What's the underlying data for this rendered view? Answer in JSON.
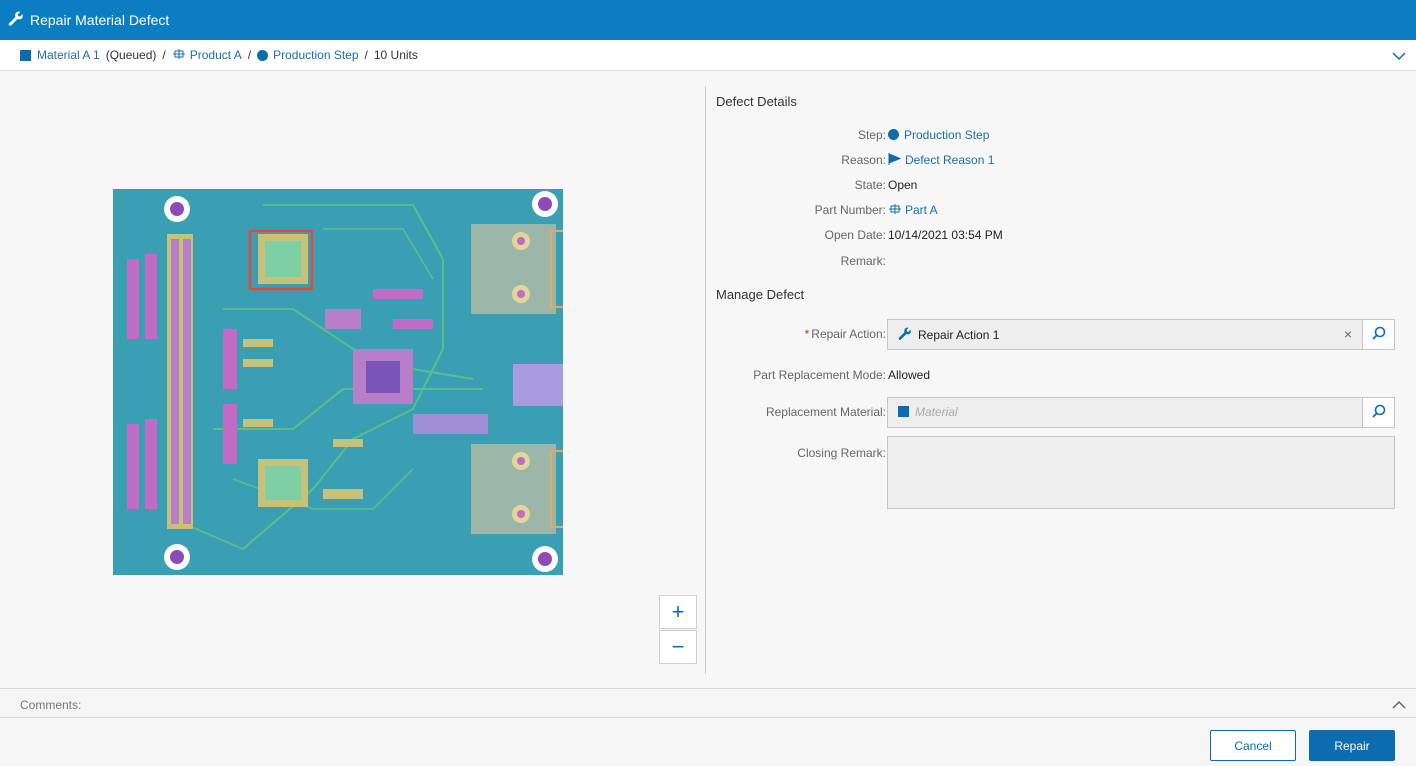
{
  "window": {
    "title": "Repair Material Defect"
  },
  "breadcrumb": {
    "material": "Material A 1",
    "material_state": "(Queued)",
    "product": "Product A",
    "step": "Production Step",
    "units": "10 Units"
  },
  "defect_details": {
    "section_title": "Defect Details",
    "step_label": "Step:",
    "step_value": "Production Step",
    "reason_label": "Reason:",
    "reason_value": "Defect Reason 1",
    "state_label": "State:",
    "state_value": "Open",
    "part_number_label": "Part Number:",
    "part_number_value": "Part A",
    "open_date_label": "Open Date:",
    "open_date_value": "10/14/2021 03:54 PM",
    "remark_label": "Remark:",
    "remark_value": ""
  },
  "manage_defect": {
    "section_title": "Manage Defect",
    "required_mark": "*",
    "repair_action_label": "Repair Action:",
    "repair_action_value": "Repair Action 1",
    "clear_symbol": "×",
    "part_replacement_mode_label": "Part Replacement Mode:",
    "part_replacement_mode_value": "Allowed",
    "replacement_material_label": "Replacement Material:",
    "replacement_material_placeholder": "Material",
    "closing_remark_label": "Closing Remark:",
    "closing_remark_value": ""
  },
  "zoom": {
    "in": "+",
    "out": "−"
  },
  "comments": {
    "label": "Comments:"
  },
  "footer": {
    "cancel": "Cancel",
    "repair": "Repair"
  },
  "colors": {
    "header": "#0b7dc2",
    "accent": "#0b6cb0",
    "link": "#1a6fad",
    "required": "#d9252a"
  },
  "icons": {
    "title": "wrench-icon",
    "material": "square-material-icon",
    "product": "product-icon",
    "step": "circle-step-icon",
    "reason": "flag-icon",
    "search": "search-icon"
  }
}
